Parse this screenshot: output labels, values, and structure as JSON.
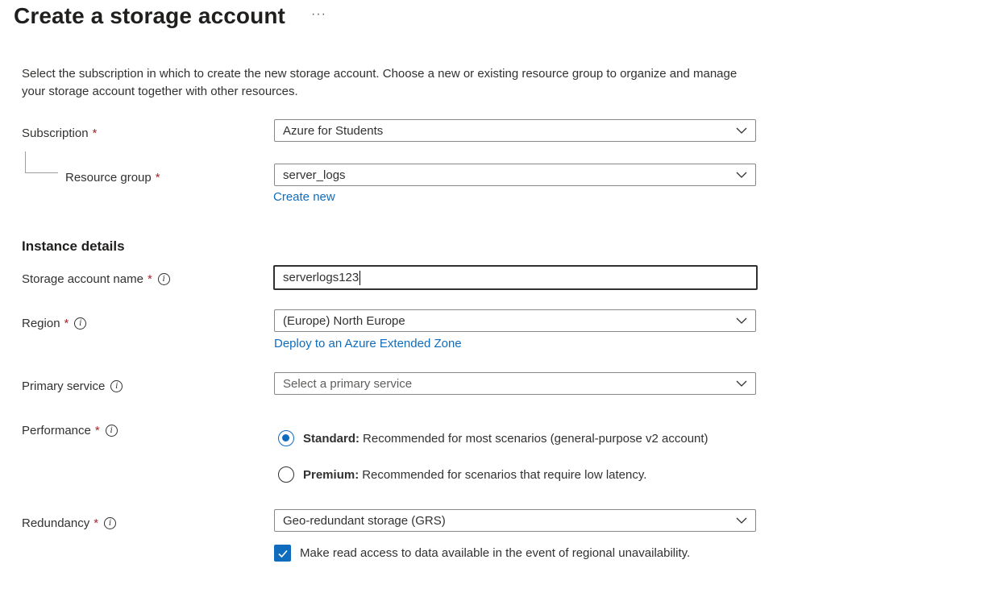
{
  "header": {
    "title": "Create a storage account",
    "more_label": "···"
  },
  "description": "Select the subscription in which to create the new storage account. Choose a new or existing resource group to organize and manage your storage account together with other resources.",
  "form": {
    "subscription": {
      "label": "Subscription",
      "required_mark": "*",
      "value": "Azure for Students"
    },
    "resource_group": {
      "label": "Resource group",
      "required_mark": "*",
      "value": "server_logs",
      "create_new_link": "Create new"
    },
    "instance_details_heading": "Instance details",
    "storage_account_name": {
      "label": "Storage account name",
      "required_mark": "*",
      "value": "serverlogs123"
    },
    "region": {
      "label": "Region",
      "required_mark": "*",
      "value": "(Europe) North Europe",
      "extended_zone_link": "Deploy to an Azure Extended Zone"
    },
    "primary_service": {
      "label": "Primary service",
      "placeholder": "Select a primary service"
    },
    "performance": {
      "label": "Performance",
      "required_mark": "*",
      "options": [
        {
          "title": "Standard:",
          "text": "Recommended for most scenarios (general-purpose v2 account)",
          "selected": true
        },
        {
          "title": "Premium:",
          "text": "Recommended for scenarios that require low latency.",
          "selected": false
        }
      ]
    },
    "redundancy": {
      "label": "Redundancy",
      "required_mark": "*",
      "value": "Geo-redundant storage (GRS)",
      "read_access_label": "Make read access to data available in the event of regional unavailability.",
      "read_access_checked": true
    }
  },
  "icons": {
    "info": "info-icon",
    "chevron": "chevron-down-icon",
    "check": "checkmark-icon"
  },
  "colors": {
    "accent": "#0f6cbd",
    "required": "#a4262c"
  }
}
